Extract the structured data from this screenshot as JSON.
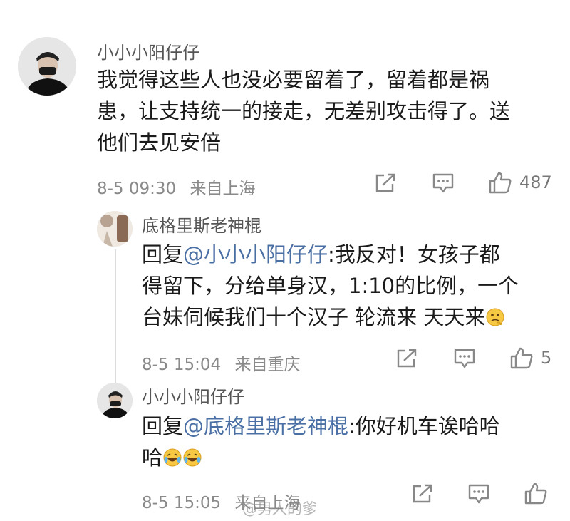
{
  "comments": [
    {
      "author": "小小小阳仔仔",
      "lines": [
        "我觉得这些人也没必要留着了，留着都是祸",
        "患，让支持统一的接走，无差别攻击得了。送",
        "他们去见安倍"
      ],
      "date": "8-5 09:30",
      "location": "来自上海",
      "likes": "487"
    },
    {
      "author": "底格里斯老神棍",
      "reply_prefix": "回复",
      "reply_to": "@小小小阳仔仔",
      "lines": [
        ":我反对！女孩子都",
        "得留下，分给单身汉，1:10的比例，一个",
        "台妹伺候我们十个汉子 轮流来 天天来"
      ],
      "date": "8-5 15:04",
      "location": "来自重庆",
      "likes": "5"
    },
    {
      "author": "小小小阳仔仔",
      "reply_prefix": "回复",
      "reply_to": "@底格里斯老神棍",
      "lines": [
        ":你好机车诶哈哈",
        "哈"
      ],
      "date": "8-5 15:05",
      "location": "来自上海",
      "likes": ""
    }
  ],
  "icons": {
    "share": "share-icon",
    "comment": "comment-icon",
    "like": "thumbs-up-icon",
    "emoji_thinking": "thinking-emoji",
    "emoji_laugh": "laughing-tears-emoji"
  },
  "watermark": "@男人的爹",
  "colors": {
    "mention": "#4a6fa5",
    "meta": "#8a8a8a"
  }
}
